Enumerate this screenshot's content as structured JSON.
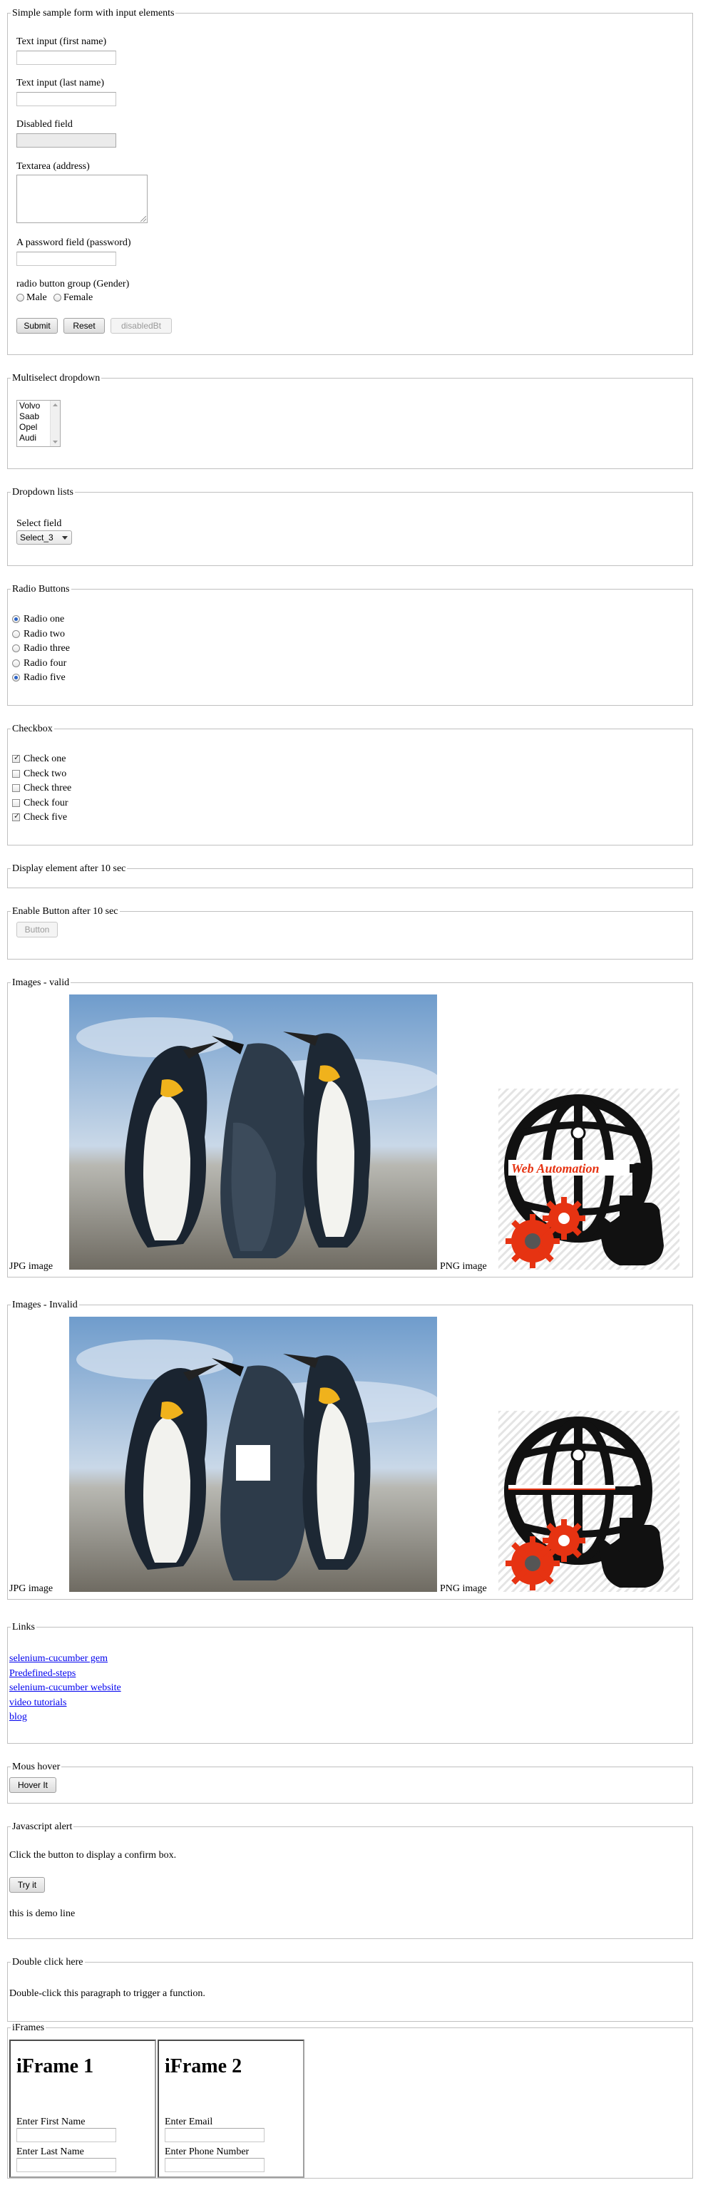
{
  "form": {
    "legend": "Simple sample form with input elements",
    "first_name_label": "Text input (first name)",
    "last_name_label": "Text input (last name)",
    "disabled_label": "Disabled field",
    "textarea_label": "Textarea (address)",
    "password_label": "A password field (password)",
    "gender_label": "radio button group (Gender)",
    "gender_options": [
      "Male",
      "Female"
    ],
    "submit_label": "Submit",
    "reset_label": "Reset",
    "disabled_button_label": "disabledBt"
  },
  "multiselect": {
    "legend": "Multiselect dropdown",
    "options": [
      "Volvo",
      "Saab",
      "Opel",
      "Audi"
    ]
  },
  "dropdown": {
    "legend": "Dropdown lists",
    "label": "Select field",
    "selected": "Select_3"
  },
  "radios": {
    "legend": "Radio Buttons",
    "items": [
      {
        "label": "Radio one",
        "checked": true
      },
      {
        "label": "Radio two",
        "checked": false
      },
      {
        "label": "Radio three",
        "checked": false
      },
      {
        "label": "Radio four",
        "checked": false
      },
      {
        "label": "Radio five",
        "checked": true
      }
    ]
  },
  "checkboxes": {
    "legend": "Checkbox",
    "items": [
      {
        "label": "Check one",
        "checked": true
      },
      {
        "label": "Check two",
        "checked": false
      },
      {
        "label": "Check three",
        "checked": false
      },
      {
        "label": "Check four",
        "checked": false
      },
      {
        "label": "Check five",
        "checked": true
      }
    ]
  },
  "display_after": {
    "legend": "Display element after 10 sec"
  },
  "enable_after": {
    "legend": "Enable Button after 10 sec",
    "button_label": "Button"
  },
  "images_valid": {
    "legend": "Images - valid",
    "jpg_label": "JPG image",
    "png_label": "PNG image",
    "logo_text": "Web Automation"
  },
  "images_invalid": {
    "legend": "Images - Invalid",
    "jpg_label": "JPG image",
    "png_label": "PNG image"
  },
  "links": {
    "legend": "Links",
    "items": [
      "selenium-cucumber gem",
      "Predefined-steps",
      "selenium-cucumber website",
      "video tutorials",
      "blog"
    ]
  },
  "hover": {
    "legend": "Mous hover",
    "button_label": "Hover It"
  },
  "alert": {
    "legend": "Javascript alert",
    "text": "Click the button to display a confirm box.",
    "button_label": "Try it",
    "demo_line": "this is demo line"
  },
  "dblclick": {
    "legend": "Double click here",
    "text": "Double-click this paragraph to trigger a function."
  },
  "iframes": {
    "legend": "iFrames",
    "frame1": {
      "title": "iFrame 1",
      "label1": "Enter First Name",
      "label2": "Enter Last Name"
    },
    "frame2": {
      "title": "iFrame 2",
      "label1": "Enter Email",
      "label2": "Enter Phone Number"
    }
  },
  "colors": {
    "link": "#0000ee",
    "gear_red": "#e63312",
    "radio_on": "#2a63c8"
  }
}
